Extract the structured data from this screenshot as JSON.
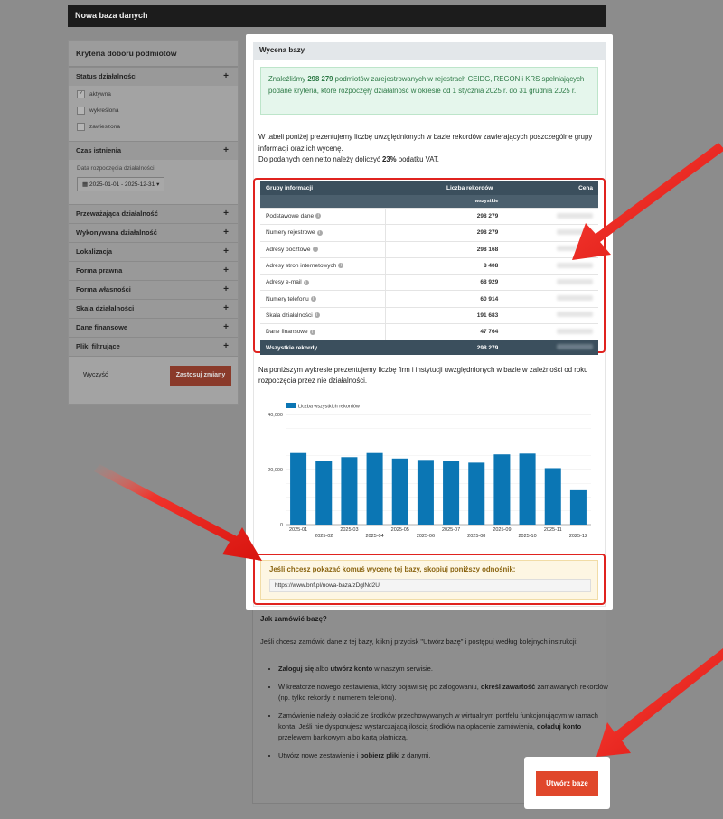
{
  "topbar": {
    "title": "Nowa baza danych"
  },
  "sidebar": {
    "title": "Kryteria doboru podmiotów",
    "status": {
      "label": "Status działalności",
      "options": [
        {
          "label": "aktywna",
          "checked": true
        },
        {
          "label": "wykreślona",
          "checked": false
        },
        {
          "label": "zawieszona",
          "checked": false
        }
      ]
    },
    "czas": {
      "label": "Czas istnienia",
      "date_label": "Data rozpoczęcia działalności",
      "date_range": "2025-01-01 - 2025-12-31"
    },
    "sections": [
      "Przeważająca działalność",
      "Wykonywana działalność",
      "Lokalizacja",
      "Forma prawna",
      "Forma własności",
      "Skala działalności",
      "Dane finansowe",
      "Pliki filtrujące"
    ],
    "clear_label": "Wyczyść",
    "apply_label": "Zastosuj zmiany"
  },
  "panel": {
    "title": "Wycena bazy",
    "info": {
      "prefix": "Znaleźliśmy ",
      "count": "298 279",
      "suffix": " podmiotów zarejestrowanych w rejestrach CEIDG, REGON i KRS spełniających podane kryteria, które rozpoczęły działalność w okresie od 1 stycznia 2025 r. do 31 grudnia 2025 r."
    },
    "p1": "W tabeli poniżej prezentujemy liczbę uwzględnionych w bazie rekordów zawierających poszczególne grupy informacji oraz ich wycenę.",
    "p2_prefix": "Do podanych cen netto należy doliczyć ",
    "p2_vat": "23%",
    "p2_suffix": " podatku VAT.",
    "table": {
      "headers": [
        "Grupy informacji",
        "Liczba rekordów",
        "Cena"
      ],
      "subheader": "wszystkie",
      "rows": [
        {
          "name": "Podstawowe dane",
          "count": "298 279"
        },
        {
          "name": "Numery rejestrowe",
          "count": "298 279"
        },
        {
          "name": "Adresy pocztowe",
          "count": "298 168"
        },
        {
          "name": "Adresy stron internetowych",
          "count": "8 408"
        },
        {
          "name": "Adresy e-mail",
          "count": "68 929"
        },
        {
          "name": "Numery telefonu",
          "count": "60 914"
        },
        {
          "name": "Skala działalności",
          "count": "191 683"
        },
        {
          "name": "Dane finansowe",
          "count": "47 764"
        }
      ],
      "total": {
        "name": "Wszystkie rekordy",
        "count": "298 279"
      }
    },
    "p3": "Na poniższym wykresie prezentujemy liczbę firm i instytucji uwzględnionych w bazie w zależności od roku rozpoczęcia przez nie działalności.",
    "share": {
      "title": "Jeśli chcesz pokazać komuś wycenę tej bazy, skopiuj poniższy odnośnik:",
      "url": "https://www.bnf.pl/nowa-baza/zDglNd2U"
    }
  },
  "chart_data": {
    "type": "bar",
    "series": [
      {
        "name": "Liczba wszystkich rekordów",
        "values": [
          26000,
          23000,
          24500,
          26000,
          24000,
          23500,
          23000,
          22500,
          25500,
          25800,
          20500,
          12500
        ]
      }
    ],
    "categories": [
      "2025-01",
      "2025-02",
      "2025-03",
      "2025-04",
      "2025-05",
      "2025-06",
      "2025-07",
      "2025-08",
      "2025-09",
      "2025-10",
      "2025-11",
      "2025-12"
    ],
    "yticks": [
      "0",
      "20,000",
      "40,000"
    ],
    "ylim": [
      0,
      40000
    ],
    "legend": "top-left",
    "color": "#0b76b4"
  },
  "lower": {
    "title": "Jak zamówić bazę?",
    "intro": "Jeśli chcesz zamówić dane z tej bazy, kliknij przycisk \"Utwórz bazę\" i postępuj według kolejnych instrukcji:",
    "step1_b1": "Zaloguj się",
    "step1_mid": " albo ",
    "step1_b2": "utwórz konto",
    "step1_end": " w naszym serwisie.",
    "step2_a": "W kreatorze nowego zestawienia, który pojawi się po zalogowaniu, ",
    "step2_b": "określ zawartość",
    "step2_c": " zamawianych rekordów (np. tylko rekordy z numerem telefonu).",
    "step3_a": "Zamówienie należy opłacić ze środków przechowywanych w wirtualnym portfelu funkcjonującym w ramach konta. Jeśli nie dysponujesz wystarczającą ilością środków na opłacenie zamówienia, ",
    "step3_b": "doładuj konto",
    "step3_c": " przelewem bankowym albo kartą płatniczą.",
    "step4_a": "Utwórz nowe zestawienie i ",
    "step4_b": "pobierz pliki",
    "step4_c": " z danymi.",
    "create_label": "Utwórz bazę"
  },
  "colors": {
    "accent": "#e0231f",
    "button": "#e0472b",
    "header_dark": "#3b4f5d",
    "bar": "#0b76b4"
  }
}
